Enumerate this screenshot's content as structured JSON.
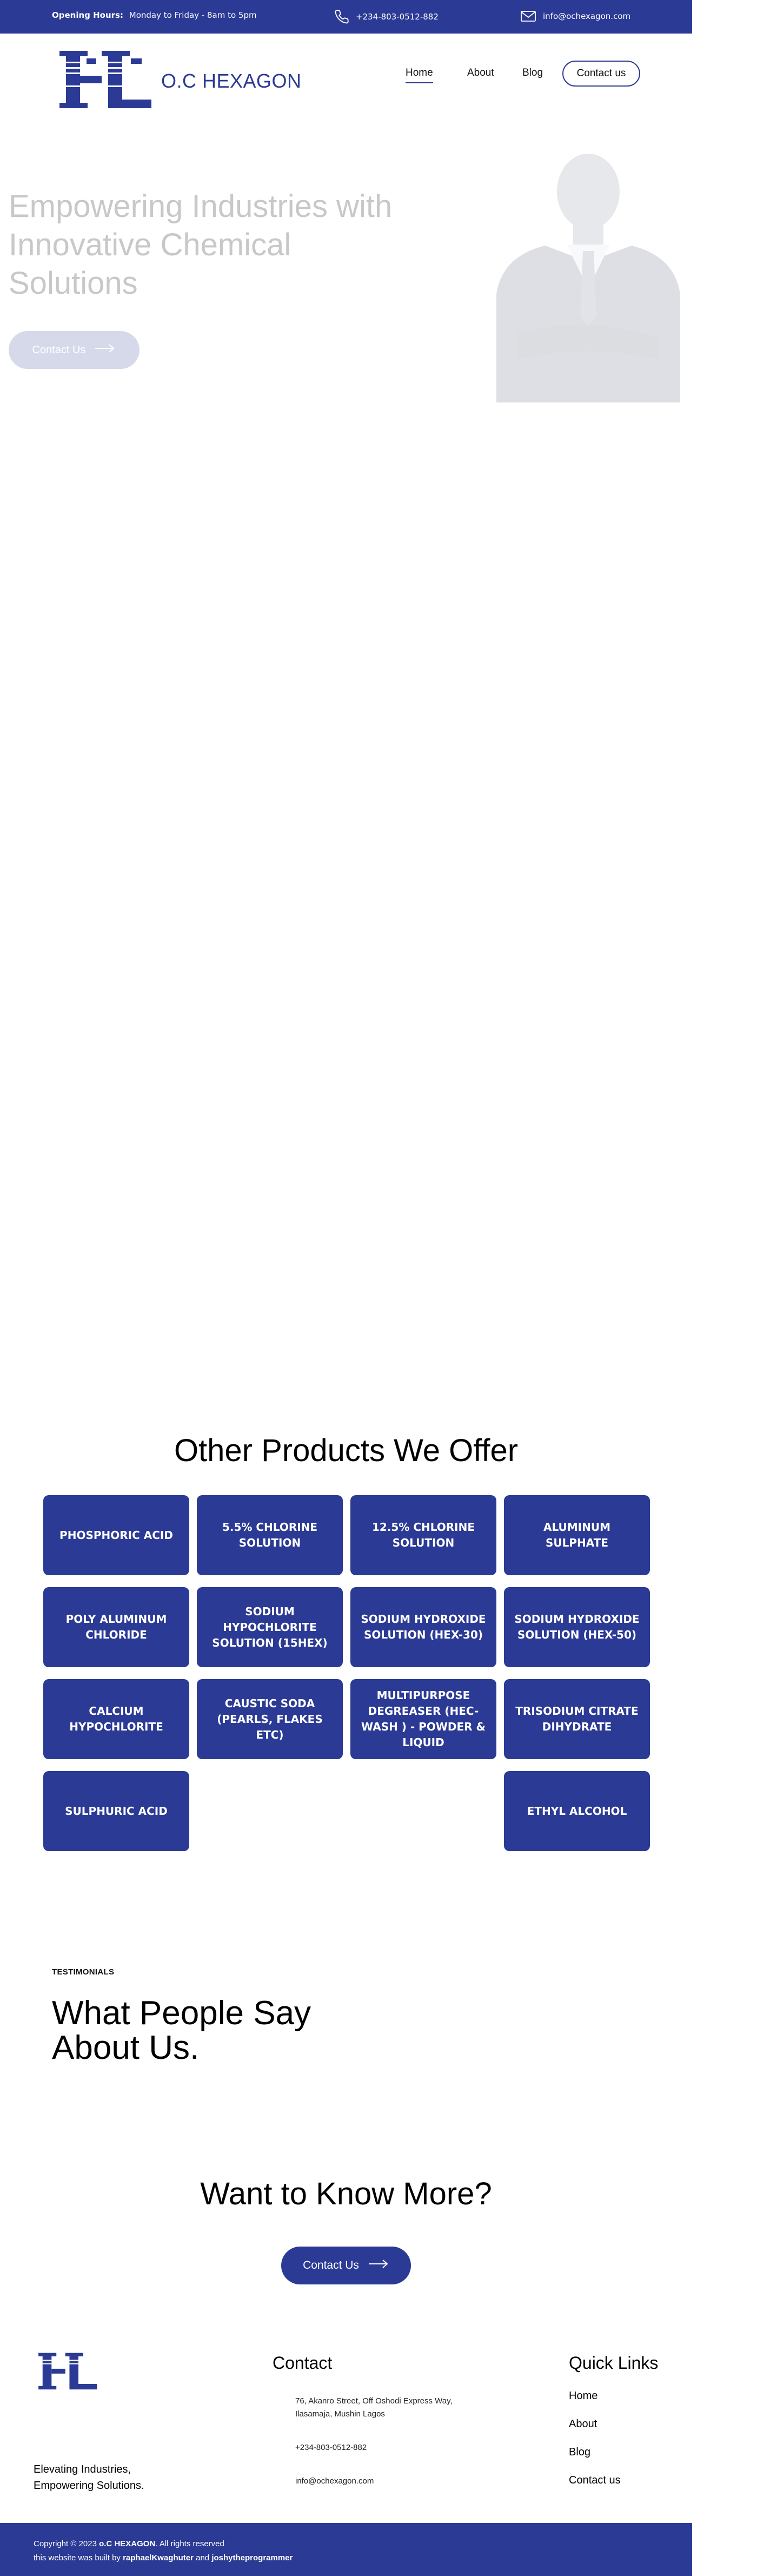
{
  "topbar": {
    "hours_label": "Opening Hours:",
    "hours_value": "Monday to Friday - 8am to 5pm",
    "phone": "+234-803-0512-882",
    "email": "info@ochexagon.com"
  },
  "brand": {
    "name": "O.C HEXAGON",
    "color": "#2b3a94"
  },
  "nav": {
    "home": "Home",
    "about": "About",
    "blog": "Blog",
    "contact": "Contact us"
  },
  "hero": {
    "title": "Empowering Industries with Innovative Chemical Solutions",
    "button": "Contact Us"
  },
  "products": {
    "title": "Other Products We Offer",
    "items": [
      "PHOSPHORIC ACID",
      "5.5% CHLORINE SOLUTION",
      "12.5% CHLORINE SOLUTION",
      "ALUMINUM SULPHATE",
      "POLY ALUMINUM CHLORIDE",
      "SODIUM HYPOCHLORITE SOLUTION (15HEX)",
      "SODIUM HYDROXIDE SOLUTION (HEX-30)",
      "SODIUM HYDROXIDE SOLUTION (HEX-50)",
      "CALCIUM HYPOCHLORITE",
      "CAUSTIC SODA (PEARLS, FLAKES ETC)",
      "MULTIPURPOSE DEGREASER (HEC-WASH ) - POWDER & LIQUID",
      "TRISODIUM CITRATE DIHYDRATE",
      "SULPHURIC ACID",
      "ETHYL ALCOHOL"
    ]
  },
  "testimonials": {
    "eyebrow": "TESTIMONIALS",
    "title": "What People Say About Us."
  },
  "cta": {
    "title": "Want to Know More?",
    "button": "Contact Us"
  },
  "footer": {
    "tagline_line1": "Elevating Industries,",
    "tagline_line2": "Empowering Solutions.",
    "contact_title": "Contact",
    "address": "76, Akanro Street, Off Oshodi Express Way, Ilasamaja, Mushin Lagos",
    "phone": "+234-803-0512-882",
    "email": "info@ochexagon.com",
    "links_title": "Quick Links",
    "links": [
      "Home",
      "About",
      "Blog",
      "Contact us"
    ]
  },
  "bottombar": {
    "copyright_pre": "Copyright © 2023",
    "copyright_brand": "o.C HEXAGON",
    "copyright_post": ". All rights reserved",
    "built_pre": "this website was built by",
    "built_author1": "raphaelKwaghuter",
    "built_and": "and",
    "built_author2": "joshytheprogrammer"
  }
}
